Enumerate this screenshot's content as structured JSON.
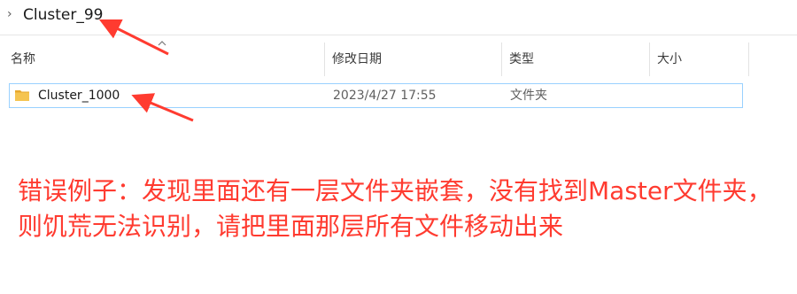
{
  "breadcrumb": {
    "chevron": "›",
    "folder": "Cluster_99"
  },
  "columns": [
    {
      "key": "name",
      "label": "名称"
    },
    {
      "key": "date",
      "label": "修改日期"
    },
    {
      "key": "type",
      "label": "类型"
    },
    {
      "key": "size",
      "label": "大小"
    }
  ],
  "sort": {
    "column": "name",
    "direction": "ascending",
    "icon": "chevron-up-icon"
  },
  "files": [
    {
      "name": "Cluster_1000",
      "modified": "2023/4/27 17:55",
      "type": "文件夹",
      "size": "",
      "icon": "folder-icon"
    }
  ],
  "annotation": {
    "text": "错误例子：发现里面还有一层文件夹嵌套，没有找到Master文件夹，则饥荒无法识别，请把里面那层所有文件移动出来",
    "color": "#ff3b30"
  },
  "colors": {
    "selection_border": "#99d1ff",
    "folder_yellow": "#f5c451",
    "arrow_red": "#ff3b30"
  }
}
